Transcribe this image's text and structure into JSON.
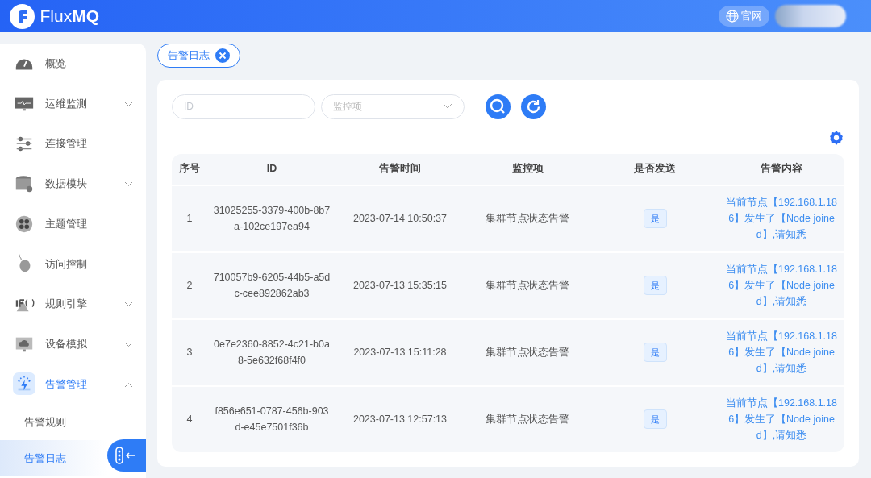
{
  "header": {
    "logo": "Flux**MQ**",
    "website_button": "官网"
  },
  "sidebar": {
    "items": [
      {
        "label": "概览",
        "selected": false
      },
      {
        "label": "运维监测",
        "expanded": false,
        "selected": false
      },
      {
        "label": "连接管理",
        "selected": false
      },
      {
        "label": "数据模块",
        "expanded": false,
        "selected": false
      },
      {
        "label": "主题管理",
        "selected": false
      },
      {
        "label": "访问控制",
        "selected": false
      },
      {
        "label": "规则引擎",
        "expanded": false,
        "selected": false
      },
      {
        "label": "设备模拟",
        "expanded": false,
        "selected": false
      },
      {
        "label": "告警管理",
        "expanded": true,
        "selected": true,
        "children": [
          {
            "label": "告警规则",
            "selected": false
          },
          {
            "label": "告警日志",
            "selected": true
          }
        ]
      }
    ]
  },
  "tabs": [
    {
      "label": "告警日志",
      "selected": true
    }
  ],
  "filters": {
    "id_placeholder": "ID",
    "monitor_placeholder": "监控项"
  },
  "table": {
    "columns": [
      "序号",
      "ID",
      "告警时间",
      "监控项",
      "是否发送",
      "告警内容"
    ],
    "rows": [
      {
        "index": "1",
        "id": "31025255-3379-400b-8b7a-102ce197ea94",
        "time": "2023-07-14 10:50:37",
        "item": "集群节点状态告警",
        "sent": "是",
        "content": "当前节点【192.168.1.186】发生了【Node joined】,请知悉"
      },
      {
        "index": "2",
        "id": "710057b9-6205-44b5-a5dc-cee892862ab3",
        "time": "2023-07-13 15:35:15",
        "item": "集群节点状态告警",
        "sent": "是",
        "content": "当前节点【192.168.1.186】发生了【Node joined】,请知悉"
      },
      {
        "index": "3",
        "id": "0e7e2360-8852-4c21-b0a8-5e632f68f4f0",
        "time": "2023-07-13 15:11:28",
        "item": "集群节点状态告警",
        "sent": "是",
        "content": "当前节点【192.168.1.186】发生了【Node joined】,请知悉"
      },
      {
        "index": "4",
        "id": "f856e651-0787-456b-903d-e45e7501f36b",
        "time": "2023-07-13 12:57:13",
        "item": "集群节点状态告警",
        "sent": "是",
        "content": "当前节点【192.168.1.186】发生了【Node joined】,请知悉"
      }
    ]
  }
}
